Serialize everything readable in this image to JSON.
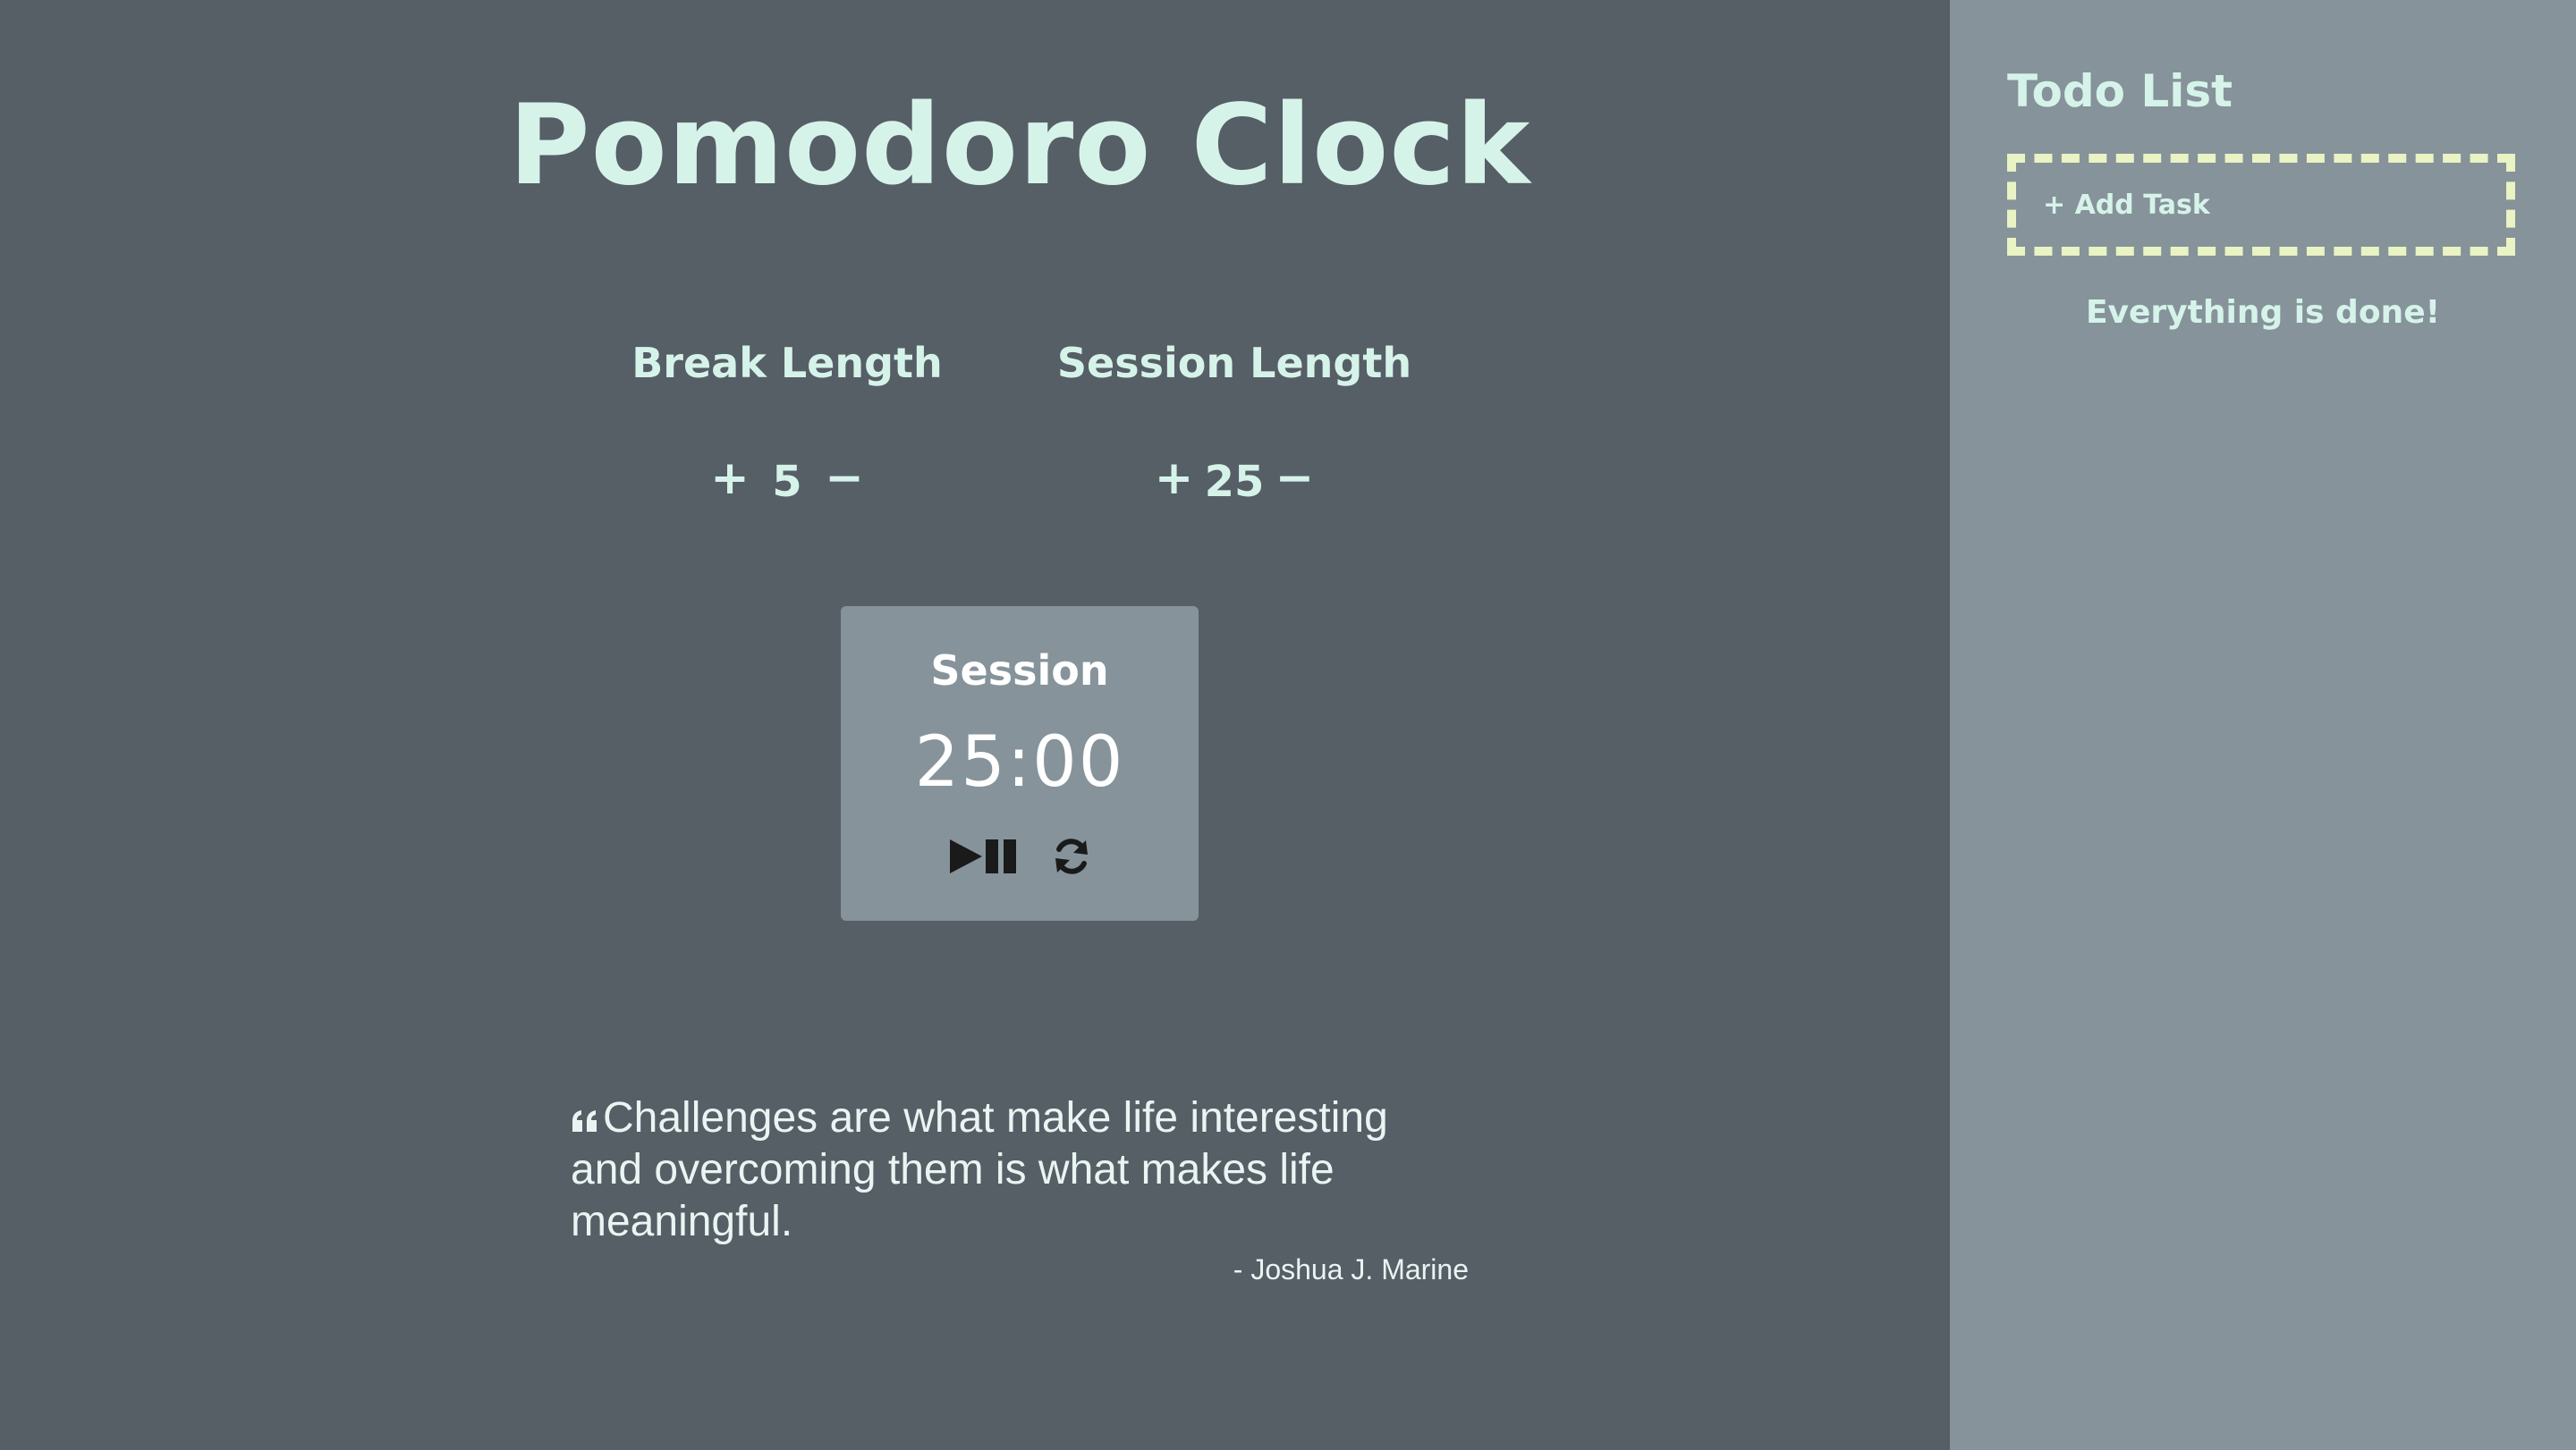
{
  "app": {
    "title": "Pomodoro Clock"
  },
  "break_control": {
    "label": "Break Length",
    "increment_label": "+",
    "value": "5",
    "decrement_label": "−"
  },
  "session_control": {
    "label": "Session Length",
    "increment_label": "+",
    "value": "25",
    "decrement_label": "−"
  },
  "timer": {
    "label": "Session",
    "time": "25:00",
    "play_pause_icon": "play-pause-icon",
    "reset_icon": "refresh-icon"
  },
  "quote": {
    "text": "Challenges are what make life interesting and overcoming them is what makes life meaningful.",
    "author": "- Joshua J. Marine",
    "icon": "quote-left-icon"
  },
  "todo": {
    "title": "Todo List",
    "add_task_label": "+ Add Task",
    "empty_message": "Everything is done!"
  },
  "colors": {
    "main_background": "#565e66",
    "sidebar_background": "#86939a",
    "accent_text": "#d6f3ea",
    "dashed_border": "#e9f3c3",
    "clock_card": "#86939a"
  }
}
